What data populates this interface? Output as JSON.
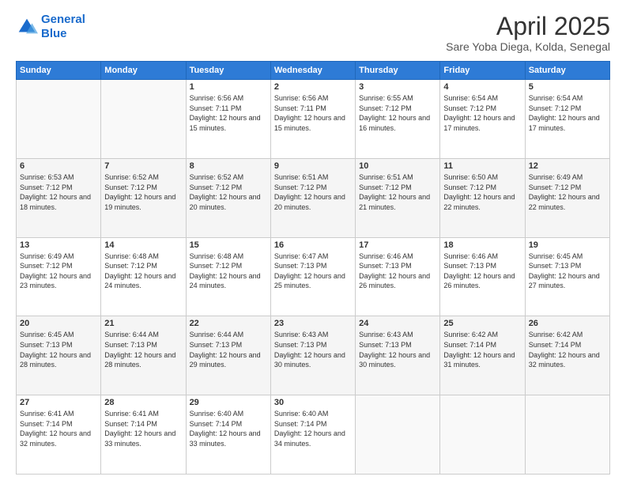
{
  "header": {
    "logo_line1": "General",
    "logo_line2": "Blue",
    "title": "April 2025",
    "location": "Sare Yoba Diega, Kolda, Senegal"
  },
  "weekdays": [
    "Sunday",
    "Monday",
    "Tuesday",
    "Wednesday",
    "Thursday",
    "Friday",
    "Saturday"
  ],
  "weeks": [
    [
      {
        "day": "",
        "info": ""
      },
      {
        "day": "",
        "info": ""
      },
      {
        "day": "1",
        "info": "Sunrise: 6:56 AM\nSunset: 7:11 PM\nDaylight: 12 hours and 15 minutes."
      },
      {
        "day": "2",
        "info": "Sunrise: 6:56 AM\nSunset: 7:11 PM\nDaylight: 12 hours and 15 minutes."
      },
      {
        "day": "3",
        "info": "Sunrise: 6:55 AM\nSunset: 7:12 PM\nDaylight: 12 hours and 16 minutes."
      },
      {
        "day": "4",
        "info": "Sunrise: 6:54 AM\nSunset: 7:12 PM\nDaylight: 12 hours and 17 minutes."
      },
      {
        "day": "5",
        "info": "Sunrise: 6:54 AM\nSunset: 7:12 PM\nDaylight: 12 hours and 17 minutes."
      }
    ],
    [
      {
        "day": "6",
        "info": "Sunrise: 6:53 AM\nSunset: 7:12 PM\nDaylight: 12 hours and 18 minutes."
      },
      {
        "day": "7",
        "info": "Sunrise: 6:52 AM\nSunset: 7:12 PM\nDaylight: 12 hours and 19 minutes."
      },
      {
        "day": "8",
        "info": "Sunrise: 6:52 AM\nSunset: 7:12 PM\nDaylight: 12 hours and 20 minutes."
      },
      {
        "day": "9",
        "info": "Sunrise: 6:51 AM\nSunset: 7:12 PM\nDaylight: 12 hours and 20 minutes."
      },
      {
        "day": "10",
        "info": "Sunrise: 6:51 AM\nSunset: 7:12 PM\nDaylight: 12 hours and 21 minutes."
      },
      {
        "day": "11",
        "info": "Sunrise: 6:50 AM\nSunset: 7:12 PM\nDaylight: 12 hours and 22 minutes."
      },
      {
        "day": "12",
        "info": "Sunrise: 6:49 AM\nSunset: 7:12 PM\nDaylight: 12 hours and 22 minutes."
      }
    ],
    [
      {
        "day": "13",
        "info": "Sunrise: 6:49 AM\nSunset: 7:12 PM\nDaylight: 12 hours and 23 minutes."
      },
      {
        "day": "14",
        "info": "Sunrise: 6:48 AM\nSunset: 7:12 PM\nDaylight: 12 hours and 24 minutes."
      },
      {
        "day": "15",
        "info": "Sunrise: 6:48 AM\nSunset: 7:12 PM\nDaylight: 12 hours and 24 minutes."
      },
      {
        "day": "16",
        "info": "Sunrise: 6:47 AM\nSunset: 7:13 PM\nDaylight: 12 hours and 25 minutes."
      },
      {
        "day": "17",
        "info": "Sunrise: 6:46 AM\nSunset: 7:13 PM\nDaylight: 12 hours and 26 minutes."
      },
      {
        "day": "18",
        "info": "Sunrise: 6:46 AM\nSunset: 7:13 PM\nDaylight: 12 hours and 26 minutes."
      },
      {
        "day": "19",
        "info": "Sunrise: 6:45 AM\nSunset: 7:13 PM\nDaylight: 12 hours and 27 minutes."
      }
    ],
    [
      {
        "day": "20",
        "info": "Sunrise: 6:45 AM\nSunset: 7:13 PM\nDaylight: 12 hours and 28 minutes."
      },
      {
        "day": "21",
        "info": "Sunrise: 6:44 AM\nSunset: 7:13 PM\nDaylight: 12 hours and 28 minutes."
      },
      {
        "day": "22",
        "info": "Sunrise: 6:44 AM\nSunset: 7:13 PM\nDaylight: 12 hours and 29 minutes."
      },
      {
        "day": "23",
        "info": "Sunrise: 6:43 AM\nSunset: 7:13 PM\nDaylight: 12 hours and 30 minutes."
      },
      {
        "day": "24",
        "info": "Sunrise: 6:43 AM\nSunset: 7:13 PM\nDaylight: 12 hours and 30 minutes."
      },
      {
        "day": "25",
        "info": "Sunrise: 6:42 AM\nSunset: 7:14 PM\nDaylight: 12 hours and 31 minutes."
      },
      {
        "day": "26",
        "info": "Sunrise: 6:42 AM\nSunset: 7:14 PM\nDaylight: 12 hours and 32 minutes."
      }
    ],
    [
      {
        "day": "27",
        "info": "Sunrise: 6:41 AM\nSunset: 7:14 PM\nDaylight: 12 hours and 32 minutes."
      },
      {
        "day": "28",
        "info": "Sunrise: 6:41 AM\nSunset: 7:14 PM\nDaylight: 12 hours and 33 minutes."
      },
      {
        "day": "29",
        "info": "Sunrise: 6:40 AM\nSunset: 7:14 PM\nDaylight: 12 hours and 33 minutes."
      },
      {
        "day": "30",
        "info": "Sunrise: 6:40 AM\nSunset: 7:14 PM\nDaylight: 12 hours and 34 minutes."
      },
      {
        "day": "",
        "info": ""
      },
      {
        "day": "",
        "info": ""
      },
      {
        "day": "",
        "info": ""
      }
    ]
  ]
}
